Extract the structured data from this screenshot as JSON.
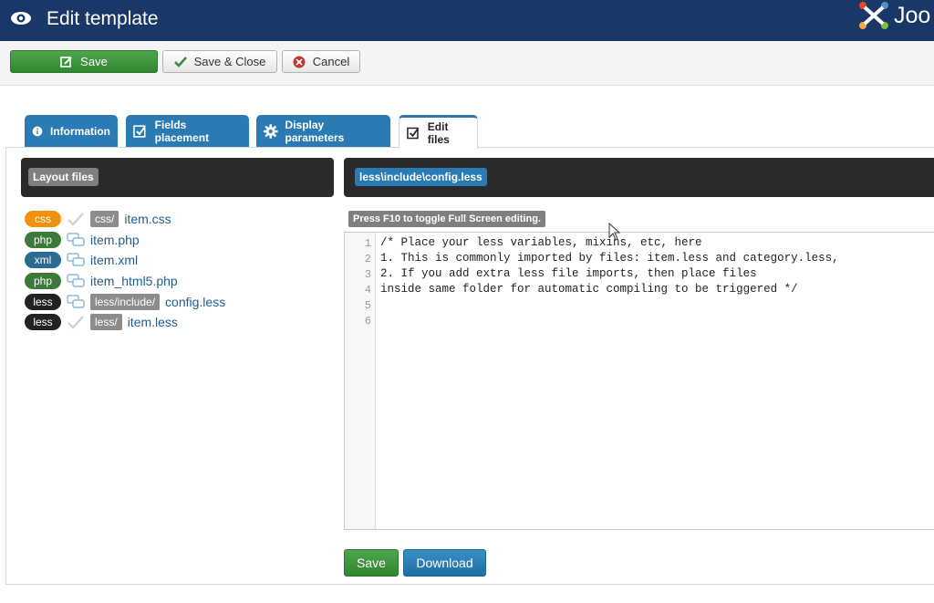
{
  "header": {
    "title": "Edit template",
    "brand": "Joo"
  },
  "toolbar": {
    "save": "Save",
    "save_close": "Save & Close",
    "cancel": "Cancel"
  },
  "tabs": [
    {
      "label": "Information",
      "icon": "info-icon"
    },
    {
      "label": "Fields placement",
      "icon": "checkbox-icon"
    },
    {
      "label": "Display parameters",
      "icon": "gear-icon"
    },
    {
      "label": "Edit files",
      "icon": "checkbox-icon",
      "active": true
    }
  ],
  "left": {
    "title": "Layout files",
    "files": [
      {
        "type": "css",
        "path": "css/",
        "name": "item.css",
        "icon": "check-icon"
      },
      {
        "type": "php",
        "path": "",
        "name": "item.php",
        "icon": "comments-icon"
      },
      {
        "type": "xml",
        "path": "",
        "name": "item.xml",
        "icon": "comments-icon"
      },
      {
        "type": "php",
        "path": "",
        "name": "item_html5.php",
        "icon": "comments-icon"
      },
      {
        "type": "less",
        "path": "less/include/",
        "name": "config.less",
        "icon": "comments-icon"
      },
      {
        "type": "less",
        "path": "less/",
        "name": "item.less",
        "icon": "check-icon"
      }
    ]
  },
  "right": {
    "file_label": "less\\include\\config.less",
    "hint": "Press F10 to toggle Full Screen editing.",
    "line_numbers": [
      "1",
      "2",
      "3",
      "4",
      "5",
      "6"
    ],
    "code": [
      "/* Place your less variables, mixins, etc, here",
      "1. This is commonly imported by files: item.less and category.less,",
      "2. If you add extra less file imports, then place files",
      "inside same folder for automatic compiling to be triggered */",
      "",
      ""
    ],
    "save": "Save",
    "download": "Download"
  },
  "colors": {
    "header": "#1a3867",
    "accent": "#2a7bb3",
    "success": "#3c9a3c",
    "dark": "#2a2a2a"
  }
}
